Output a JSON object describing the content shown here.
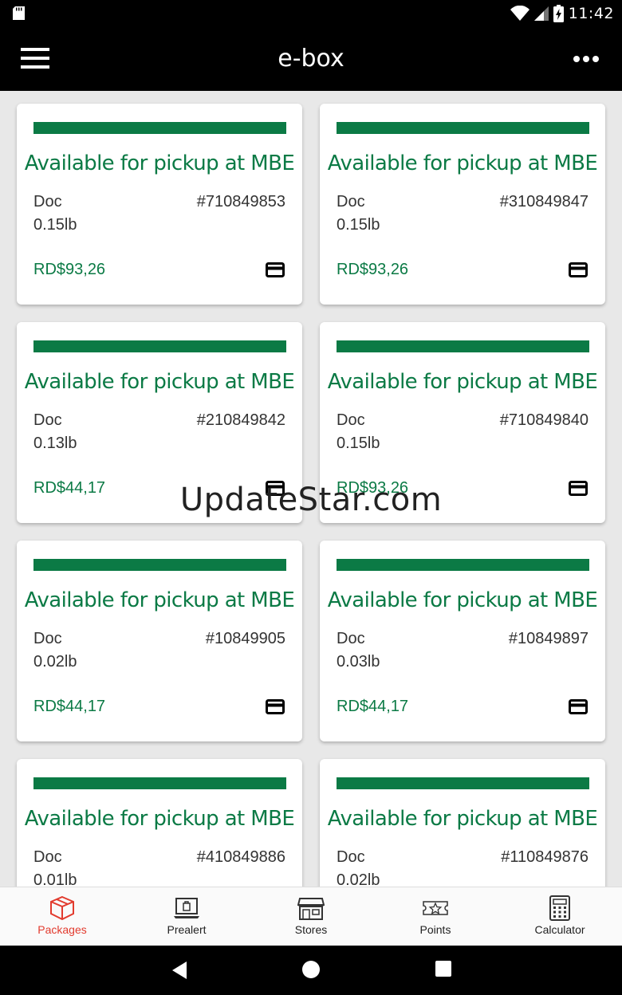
{
  "status_bar": {
    "time": "11:42"
  },
  "app_bar": {
    "title": "e-box"
  },
  "packages": [
    {
      "status": "Available for pickup at MBE",
      "type": "Doc",
      "number": "#710849853",
      "weight": "0.15lb",
      "price": "RD$93,26"
    },
    {
      "status": "Available for pickup at MBE",
      "type": "Doc",
      "number": "#310849847",
      "weight": "0.15lb",
      "price": "RD$93,26"
    },
    {
      "status": "Available for pickup at MBE",
      "type": "Doc",
      "number": "#210849842",
      "weight": "0.13lb",
      "price": "RD$44,17"
    },
    {
      "status": "Available for pickup at MBE",
      "type": "Doc",
      "number": "#710849840",
      "weight": "0.15lb",
      "price": "RD$93,26"
    },
    {
      "status": "Available for pickup at MBE",
      "type": "Doc",
      "number": "#10849905",
      "weight": "0.02lb",
      "price": "RD$44,17"
    },
    {
      "status": "Available for pickup at MBE",
      "type": "Doc",
      "number": "#10849897",
      "weight": "0.03lb",
      "price": "RD$44,17"
    },
    {
      "status": "Available for pickup at MBE",
      "type": "Doc",
      "number": "#410849886",
      "weight": "0.01lb",
      "price": ""
    },
    {
      "status": "Available for pickup at MBE",
      "type": "Doc",
      "number": "#110849876",
      "weight": "0.02lb",
      "price": ""
    }
  ],
  "watermark": "UpdateStar.com",
  "bottom_nav": {
    "items": [
      {
        "label": "Packages",
        "icon": "package-icon",
        "active": true
      },
      {
        "label": "Prealert",
        "icon": "laptop-bag-icon",
        "active": false
      },
      {
        "label": "Stores",
        "icon": "store-icon",
        "active": false
      },
      {
        "label": "Points",
        "icon": "ticket-star-icon",
        "active": false
      },
      {
        "label": "Calculator",
        "icon": "calculator-icon",
        "active": false
      }
    ]
  },
  "colors": {
    "brand_green": "#0b7a45",
    "active_red": "#e23b2e"
  }
}
